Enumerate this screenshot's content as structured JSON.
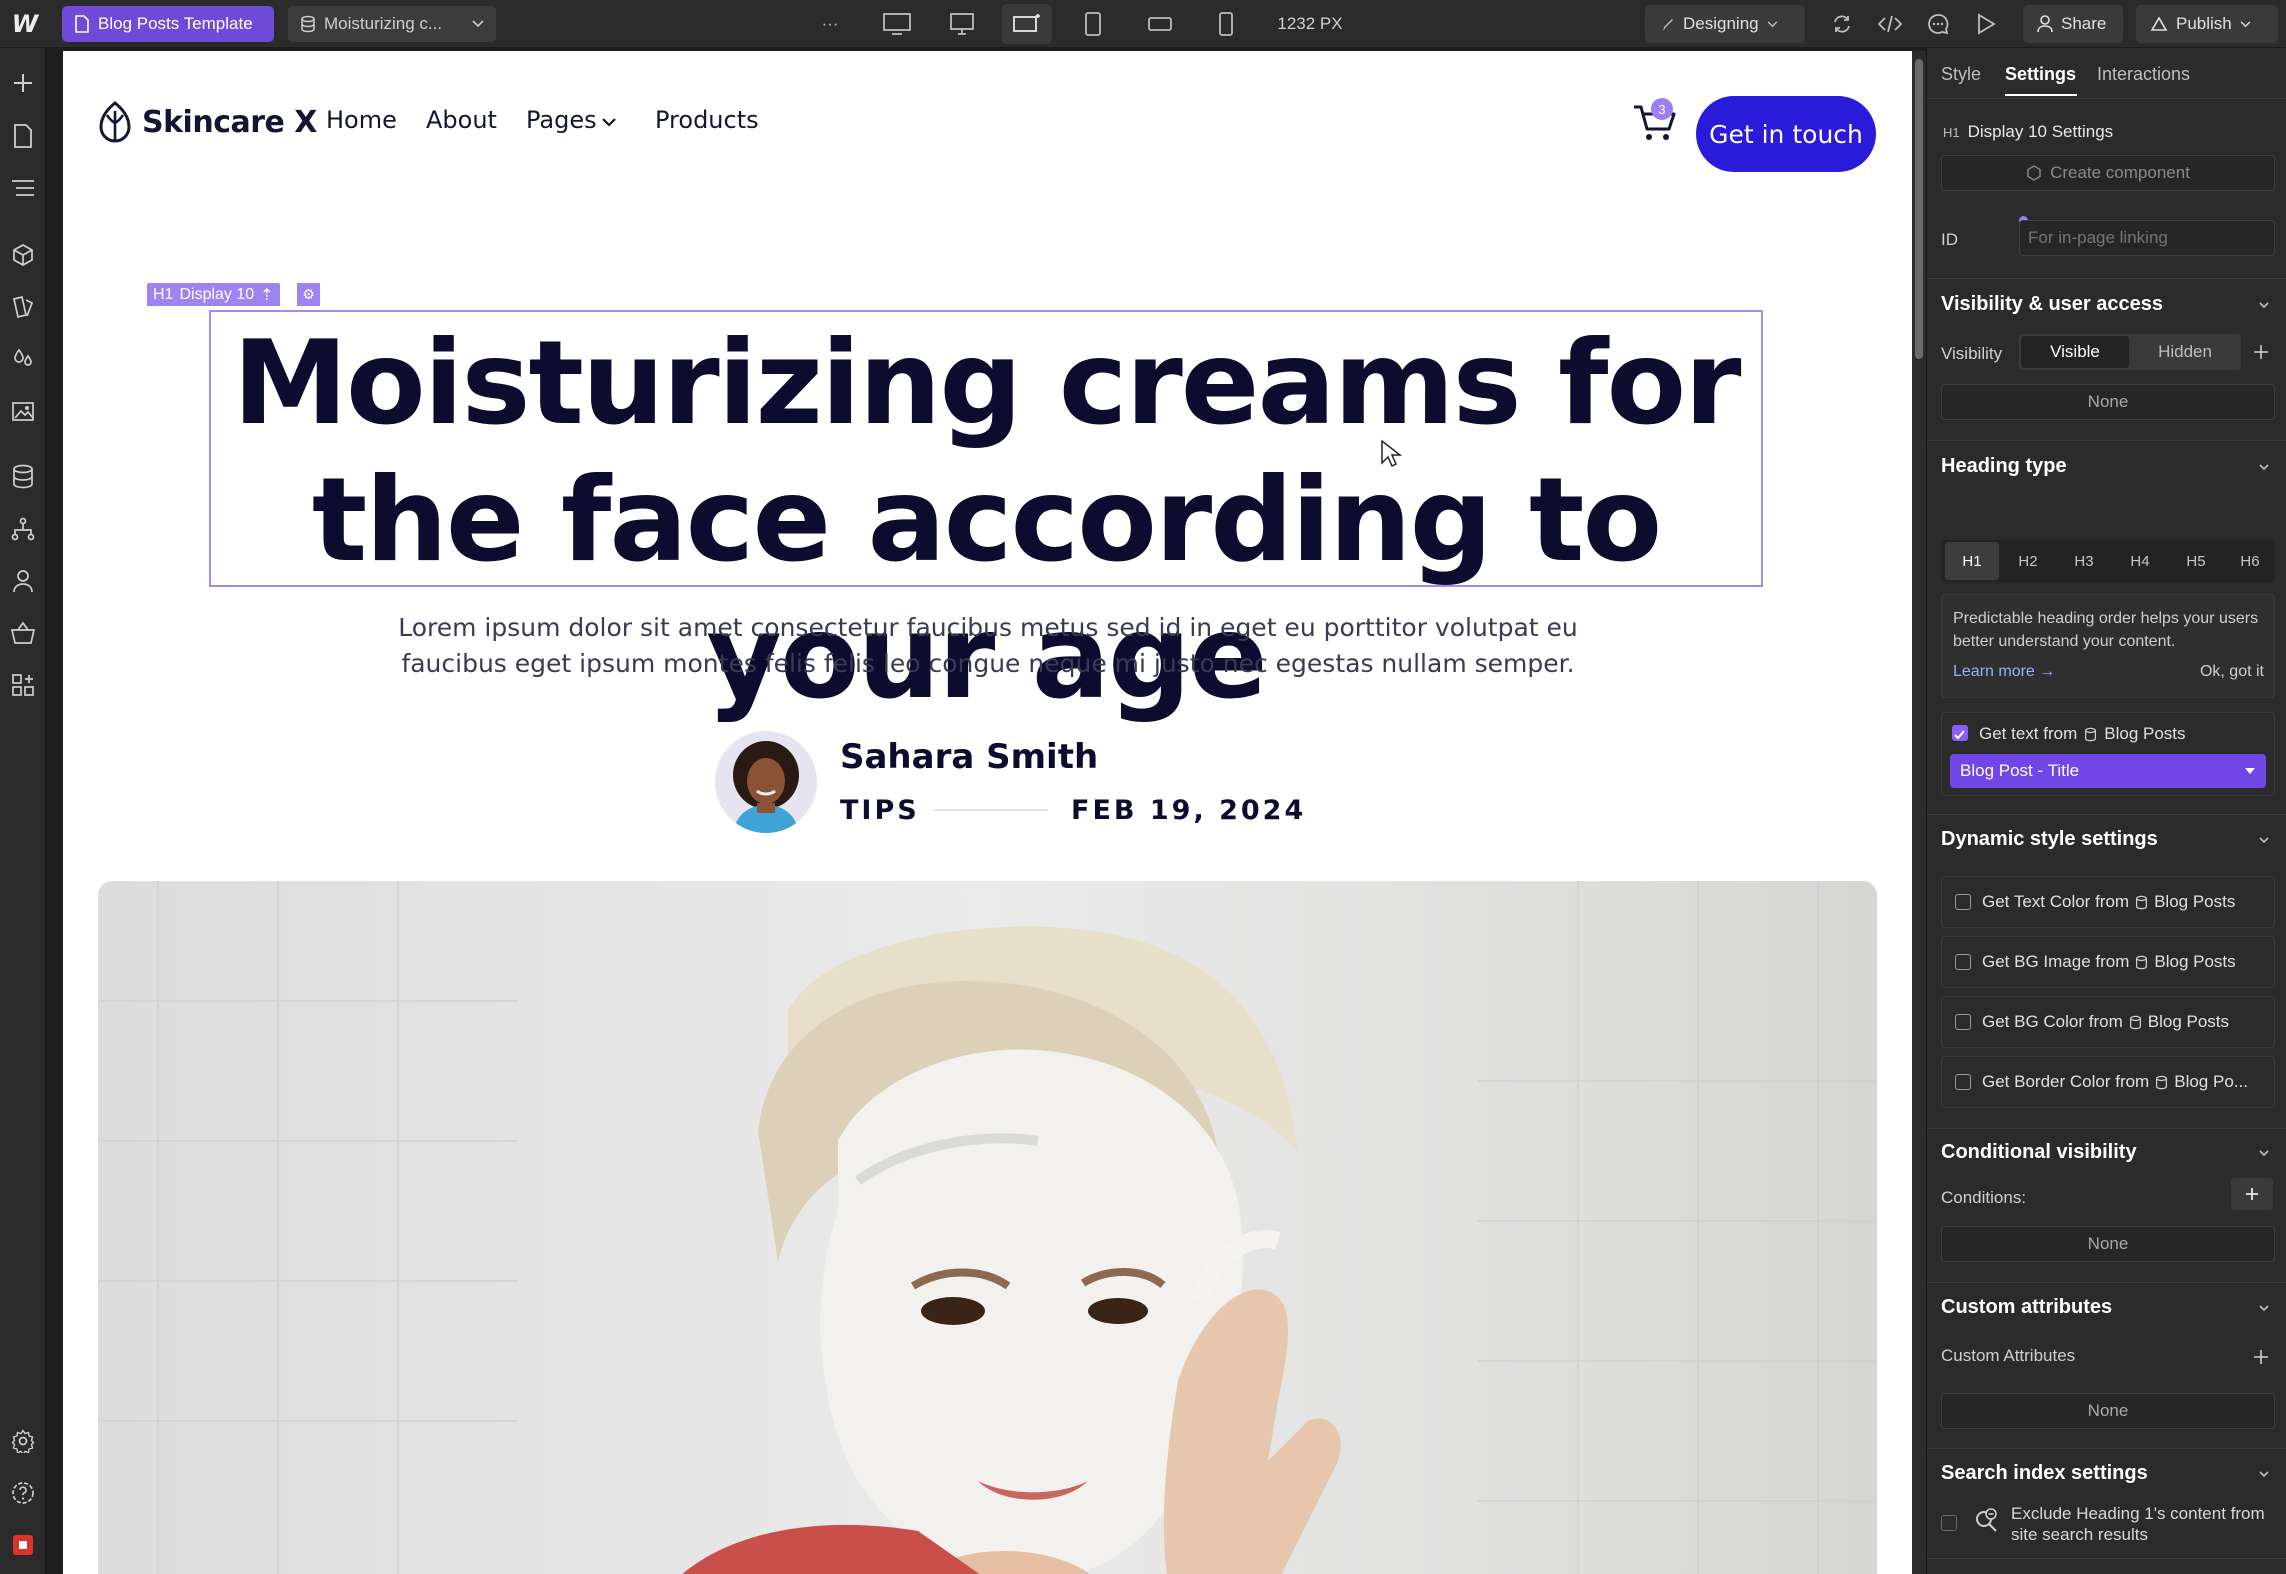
{
  "topbar": {
    "template_label": "Blog Posts Template",
    "item_label": "Moisturizing c...",
    "more_label": "···",
    "width_label": "1232 PX",
    "mode_label": "Designing",
    "share_label": "Share",
    "publish_label": "Publish"
  },
  "site": {
    "brand": "Skincare X",
    "nav": [
      "Home",
      "About",
      "Pages",
      "Products"
    ],
    "cart_count": "3",
    "cta": "Get in touch"
  },
  "selection": {
    "tag": "H1",
    "label": "Display 10"
  },
  "post": {
    "title": "Moisturizing creams for the face according to your age",
    "lead": "Lorem ipsum dolor sit amet consectetur faucibus metus sed id in eget eu porttitor volutpat eu faucibus eget ipsum montes felis felis leo congue neque mi justo nec egestas nullam semper.",
    "author": "Sahara Smith",
    "category": "TIPS",
    "date": "FEB 19, 2024"
  },
  "panel": {
    "tabs": [
      "Style",
      "Settings",
      "Interactions"
    ],
    "element_tag": "H1",
    "element_title": "Display 10 Settings",
    "create_component": "Create component",
    "id_label": "ID",
    "id_placeholder": "For in-page linking",
    "visibility_title": "Visibility & user access",
    "visibility_label": "Visibility",
    "visible": "Visible",
    "hidden": "Hidden",
    "none": "None",
    "heading_type_title": "Heading type",
    "heading_levels": [
      "H1",
      "H2",
      "H3",
      "H4",
      "H5",
      "H6"
    ],
    "heading_note": "Predictable heading order helps your users better understand your content.",
    "learn_more": "Learn more →",
    "ok_got_it": "Ok, got it",
    "get_text_from": "Get text from",
    "collection": "Blog Posts",
    "field_value": "Blog Post - Title",
    "dynamic_title": "Dynamic style settings",
    "dynamic_rows": [
      {
        "label": "Get Text Color from",
        "source": "Blog Posts"
      },
      {
        "label": "Get BG Image from",
        "source": "Blog Posts"
      },
      {
        "label": "Get BG Color from",
        "source": "Blog Posts"
      },
      {
        "label": "Get Border Color from",
        "source": "Blog Po..."
      }
    ],
    "conditional_title": "Conditional visibility",
    "conditions_label": "Conditions:",
    "custom_attr_title": "Custom attributes",
    "custom_attr_label": "Custom Attributes",
    "search_title": "Search index settings",
    "search_exclude": "Exclude Heading 1's content from site search results"
  },
  "colors": {
    "accent": "#6f4ad8",
    "cta": "#2a1ad9",
    "selection": "#a58bf0",
    "heading": "#0d0b2e"
  }
}
